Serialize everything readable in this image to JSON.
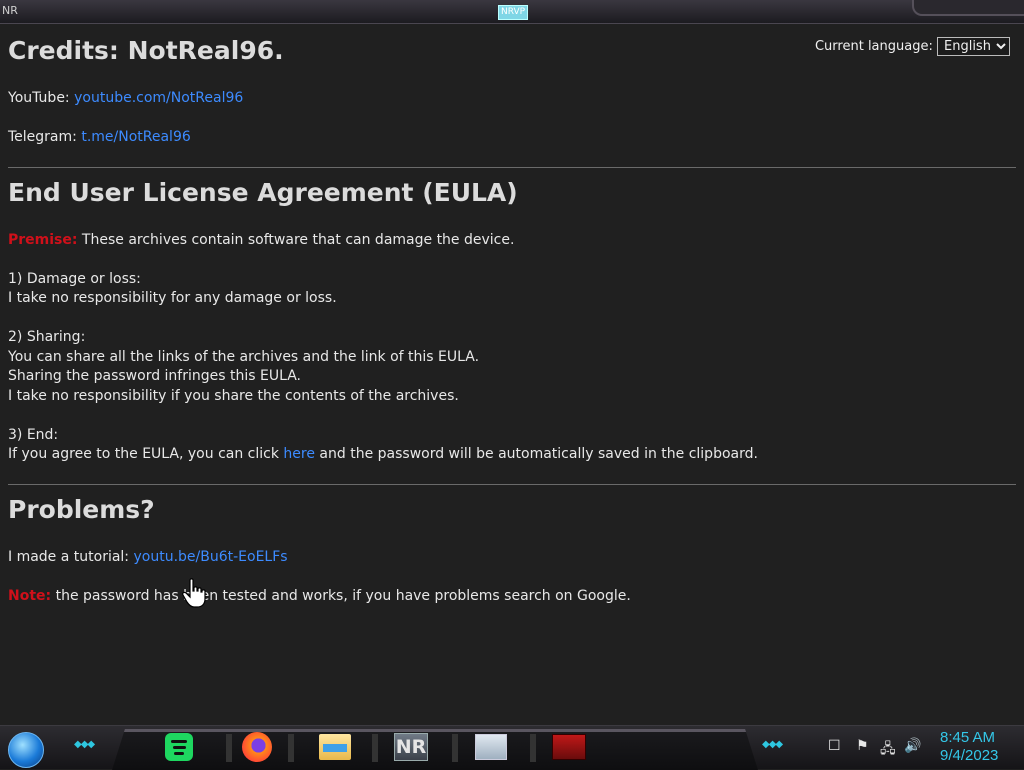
{
  "window": {
    "app_name": "NR",
    "badge": "NRVP"
  },
  "language": {
    "label": "Current language:",
    "selected": "English"
  },
  "credits": {
    "title": "Credits: NotReal96.",
    "youtube_label": "YouTube: ",
    "youtube_link": "youtube.com/NotReal96",
    "telegram_label": "Telegram: ",
    "telegram_link": "t.me/NotReal96"
  },
  "eula": {
    "title": "End User License Agreement (EULA)",
    "premise_label": "Premise:",
    "premise_text": " These archives contain software that can damage the device.",
    "s1_title": "1) Damage or loss:",
    "s1_line1": "I take no responsibility for any damage or loss.",
    "s2_title": "2) Sharing:",
    "s2_line1": "You can share all the links of the archives and the link of this EULA.",
    "s2_line2": "Sharing the password infringes this EULA.",
    "s2_line3": "I take no responsibility if you share the contents of the archives.",
    "s3_title": "3) End:",
    "s3_before": "If you agree to the EULA, you can click ",
    "s3_link": "here",
    "s3_after": " and the password will be automatically saved in the clipboard."
  },
  "problems": {
    "title": "Problems?",
    "tutorial_label": "I made a tutorial: ",
    "tutorial_link": "youtu.be/Bu6t-EoELFs",
    "note_label": "Note:",
    "note_text": " the password has been tested and works, if you have problems search on Google."
  },
  "taskbar": {
    "apps": [
      "spotify-icon",
      "firefox-icon",
      "file-explorer-icon",
      "nr-app-icon",
      "task-manager-icon",
      "red-tool-icon"
    ],
    "nr_text": "NR",
    "time": "8:45 AM",
    "date": "9/4/2023"
  },
  "colors": {
    "link": "#3d8bff",
    "warning": "#d0101a",
    "clock": "#34c7e8"
  }
}
